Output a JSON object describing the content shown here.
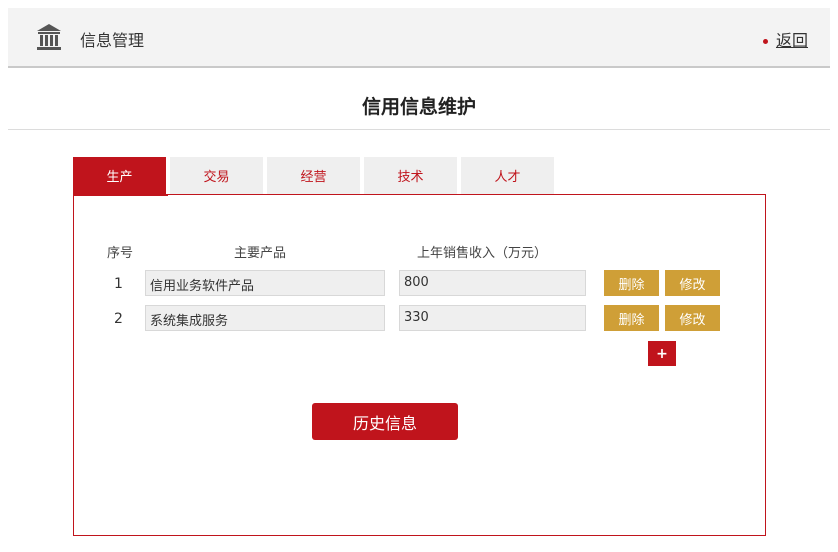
{
  "header": {
    "title": "信息管理",
    "back_label": "返回",
    "icon": "bank-building-icon"
  },
  "page": {
    "title": "信用信息维护"
  },
  "tabs": [
    {
      "label": "生产",
      "active": true
    },
    {
      "label": "交易",
      "active": false
    },
    {
      "label": "经营",
      "active": false
    },
    {
      "label": "技术",
      "active": false
    },
    {
      "label": "人才",
      "active": false
    }
  ],
  "table": {
    "headers": {
      "seq": "序号",
      "product": "主要产品",
      "revenue": "上年销售收入（万元）"
    },
    "rows": [
      {
        "seq": "1",
        "product": "信用业务软件产品",
        "revenue": "800",
        "delete_label": "删除",
        "edit_label": "修改"
      },
      {
        "seq": "2",
        "product": "系统集成服务",
        "revenue": "330",
        "delete_label": "删除",
        "edit_label": "修改"
      }
    ],
    "add_label": "+"
  },
  "history_button": "历史信息",
  "colors": {
    "accent_red": "#c0141c",
    "button_gold": "#cf9f37",
    "tab_inactive_bg": "#efefef"
  }
}
